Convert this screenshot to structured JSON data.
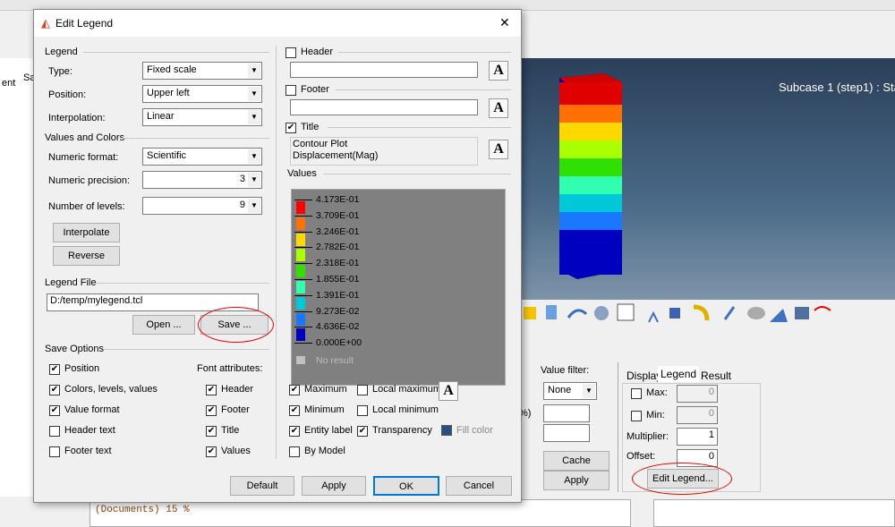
{
  "app": {
    "left_header": [
      "ent",
      "Sa M"
    ],
    "subcase": "Subcase 1 (step1) : Sta",
    "console": "(Documents) 15 %"
  },
  "panel": {
    "value_filter_label": "Value filter:",
    "value_filter": "None",
    "percent": "%)",
    "cache": "Cache",
    "apply": "Apply",
    "tabs": [
      "Display",
      "Legend",
      "Result"
    ],
    "active_tab": "Legend",
    "max_label": "Max:",
    "max_value": "0",
    "min_label": "Min:",
    "min_value": "0",
    "multiplier_label": "Multiplier:",
    "multiplier": "1",
    "offset_label": "Offset:",
    "offset": "0",
    "edit_legend": "Edit Legend..."
  },
  "dialog": {
    "title": "Edit Legend",
    "close": "✕",
    "legend_group": "Legend",
    "type_label": "Type:",
    "type": "Fixed scale",
    "position_label": "Position:",
    "position": "Upper left",
    "interp_label": "Interpolation:",
    "interp": "Linear",
    "values_colors_group": "Values and Colors",
    "numfmt_label": "Numeric format:",
    "numfmt": "Scientific",
    "precision_label": "Numeric precision:",
    "precision": "3",
    "levels_label": "Number of levels:",
    "levels": "9",
    "interpolate": "Interpolate",
    "reverse": "Reverse",
    "legend_file_group": "Legend File",
    "legend_file": "D:/temp/mylegend.tcl",
    "open": "Open ...",
    "save": "Save ...",
    "save_options_group": "Save Options",
    "font_attr_label": "Font attributes:",
    "save_options": [
      {
        "label": "Position",
        "checked": true
      },
      {
        "label": "Colors, levels, values",
        "checked": true
      },
      {
        "label": "Value format",
        "checked": true
      },
      {
        "label": "Header text",
        "checked": false
      },
      {
        "label": "Footer text",
        "checked": false
      }
    ],
    "font_attrs": [
      {
        "label": "Header",
        "checked": true
      },
      {
        "label": "Footer",
        "checked": true
      },
      {
        "label": "Title",
        "checked": true
      },
      {
        "label": "Values",
        "checked": true
      }
    ],
    "header_label": "Header",
    "header_checked": false,
    "header_text": "",
    "footer_label": "Footer",
    "footer_checked": false,
    "footer_text": "",
    "title_label": "Title",
    "title_checked": true,
    "title_text": [
      "Contour Plot",
      "Displacement(Mag)"
    ],
    "font_button": "A",
    "values_group": "Values",
    "levels_values": [
      "4.173E-01",
      "3.709E-01",
      "3.246E-01",
      "2.782E-01",
      "2.318E-01",
      "1.855E-01",
      "1.391E-01",
      "9.273E-02",
      "4.636E-02",
      "0.000E+00"
    ],
    "level_colors": [
      "#ff0000",
      "#ff7000",
      "#ffd800",
      "#aaff00",
      "#30e000",
      "#30ffb0",
      "#00c8d8",
      "#1a78ff",
      "#0000c0"
    ],
    "no_result": "No result",
    "opts": [
      {
        "label": "Maximum",
        "checked": true
      },
      {
        "label": "Local maximum",
        "checked": false
      },
      {
        "label": "Minimum",
        "checked": true
      },
      {
        "label": "Local minimum",
        "checked": false
      },
      {
        "label": "Entity label",
        "checked": true
      },
      {
        "label": "Transparency",
        "checked": true
      },
      {
        "label": "By Model",
        "checked": false
      }
    ],
    "fill_color": "Fill color",
    "fill_color_value": "#2a4f80",
    "default": "Default",
    "apply": "Apply",
    "ok": "OK",
    "cancel": "Cancel"
  },
  "annotation_color": "#e00000"
}
